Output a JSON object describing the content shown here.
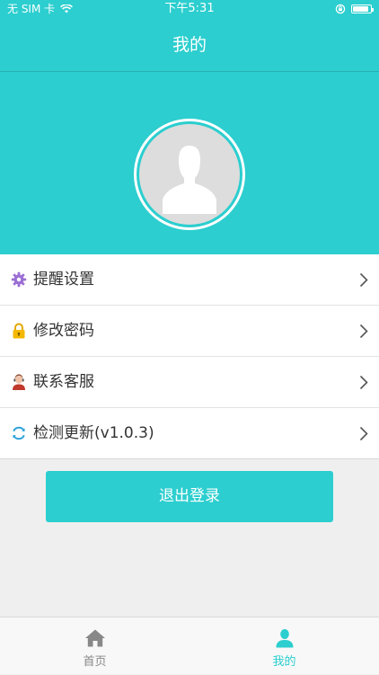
{
  "status_bar": {
    "carrier": "无 SIM 卡",
    "time": "下午5:31",
    "battery_level": 0.9
  },
  "nav": {
    "title": "我的"
  },
  "menu": {
    "items": [
      {
        "label": "提醒设置",
        "icon": "gear-icon"
      },
      {
        "label": "修改密码",
        "icon": "lock-icon"
      },
      {
        "label": "联系客服",
        "icon": "customer-service-icon"
      },
      {
        "label": "检测更新(v1.0.3)",
        "icon": "refresh-icon"
      }
    ]
  },
  "logout": {
    "label": "退出登录"
  },
  "tab_bar": {
    "tabs": [
      {
        "label": "首页",
        "icon": "home-icon",
        "active": false
      },
      {
        "label": "我的",
        "icon": "user-icon",
        "active": true
      }
    ]
  },
  "colors": {
    "accent": "#2ccecf",
    "inactive_tab": "#888888",
    "active_tab": "#2ccecf"
  }
}
